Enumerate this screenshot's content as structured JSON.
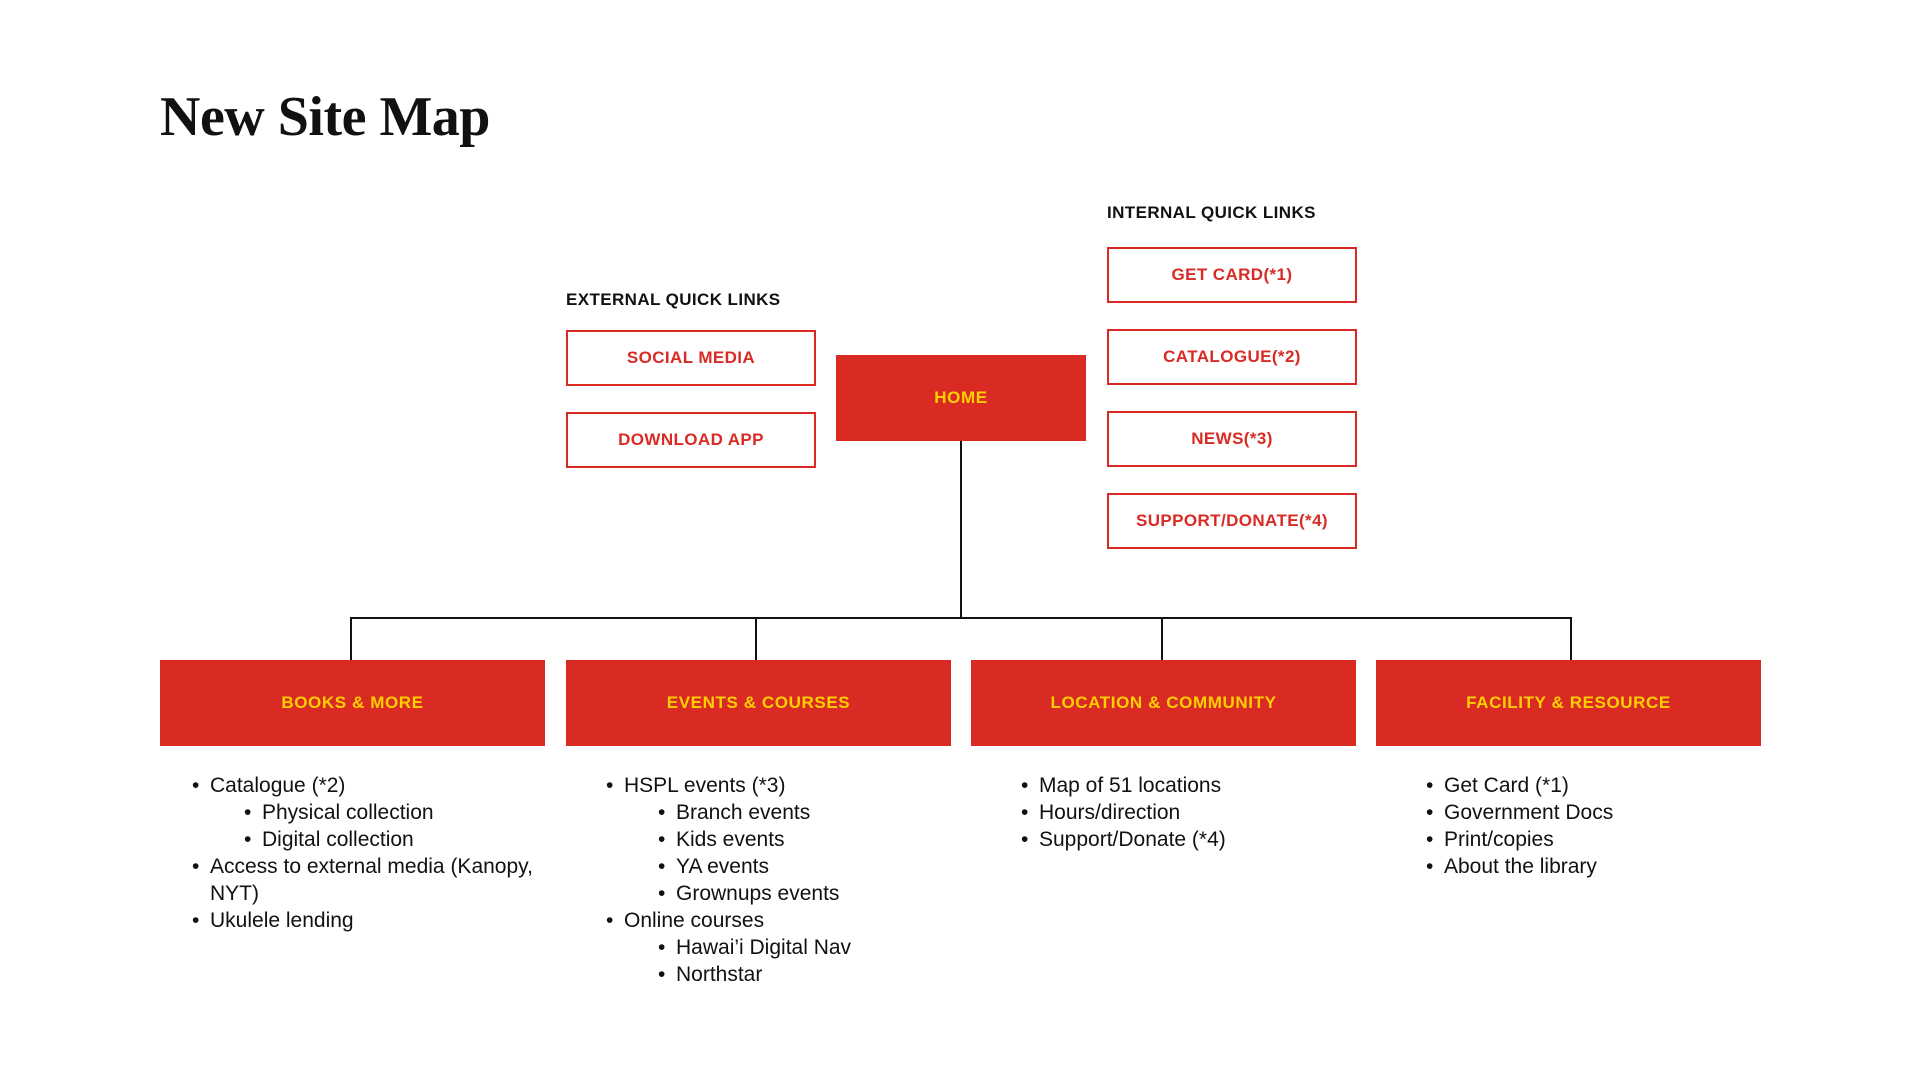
{
  "page": {
    "title": "New Site Map",
    "accent_red": "#D92B24",
    "accent_yellow": "#FFD000",
    "text_black": "#111111"
  },
  "external_quick_links": {
    "label": "EXTERNAL QUICK LINKS",
    "items": [
      {
        "label": "SOCIAL MEDIA"
      },
      {
        "label": "DOWNLOAD APP"
      }
    ]
  },
  "internal_quick_links": {
    "label": "INTERNAL QUICK LINKS",
    "items": [
      {
        "label": "GET CARD(*1)"
      },
      {
        "label": "CATALOGUE(*2)"
      },
      {
        "label": "NEWS(*3)"
      },
      {
        "label": "SUPPORT/DONATE(*4)"
      }
    ]
  },
  "home": {
    "label": "HOME"
  },
  "categories": [
    {
      "label": "BOOKS & MORE",
      "items": [
        {
          "text": "Catalogue (*2)",
          "children": [
            "Physical collection",
            "Digital collection"
          ]
        },
        {
          "text": "Access to external media (Kanopy, NYT)",
          "children": []
        },
        {
          "text": "Ukulele lending",
          "children": []
        }
      ]
    },
    {
      "label": "EVENTS & COURSES",
      "items": [
        {
          "text": "HSPL events (*3)",
          "children": [
            "Branch events",
            "Kids events",
            "YA events",
            "Grownups events"
          ]
        },
        {
          "text": "Online courses",
          "children": [
            "Hawai’i Digital Nav",
            "Northstar"
          ]
        }
      ]
    },
    {
      "label": "LOCATION & COMMUNITY",
      "items": [
        {
          "text": "Map of 51 locations",
          "children": []
        },
        {
          "text": "Hours/direction",
          "children": []
        },
        {
          "text": "Support/Donate (*4)",
          "children": []
        }
      ]
    },
    {
      "label": "FACILITY & RESOURCE",
      "items": [
        {
          "text": "Get Card (*1)",
          "children": []
        },
        {
          "text": "Government Docs",
          "children": []
        },
        {
          "text": "Print/copies",
          "children": []
        },
        {
          "text": "About the library",
          "children": []
        }
      ]
    }
  ]
}
